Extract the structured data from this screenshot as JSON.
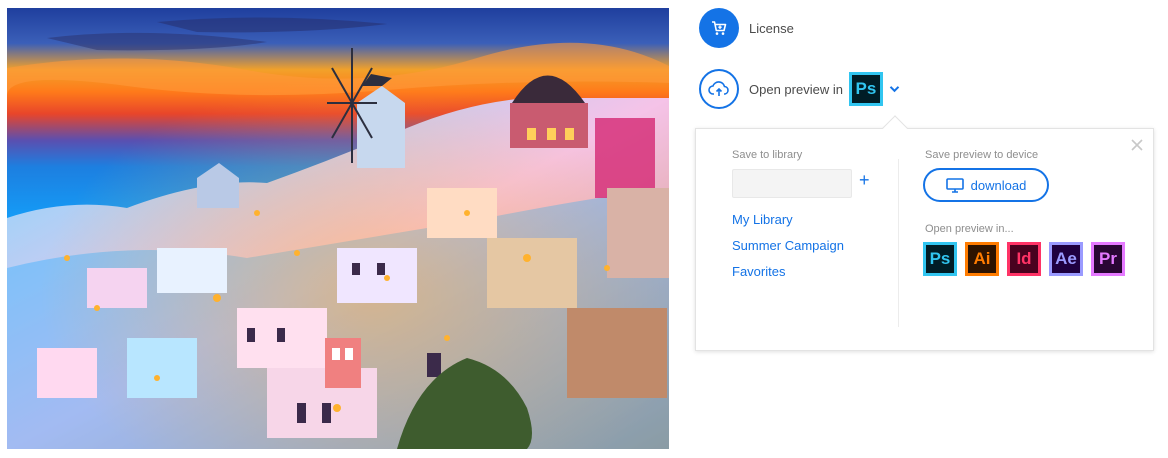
{
  "actions": {
    "license_label": "License",
    "open_preview_label": "Open preview in",
    "current_app": {
      "abbr": "Ps",
      "bg": "#001d26",
      "fg": "#31c5f0"
    }
  },
  "popover": {
    "library": {
      "title": "Save to library",
      "input_value": "",
      "add_icon": "+",
      "items": [
        {
          "label": "My Library"
        },
        {
          "label": "Summer Campaign"
        },
        {
          "label": "Favorites"
        }
      ]
    },
    "device": {
      "title": "Save preview to device",
      "download_label": "download"
    },
    "open_in": {
      "title": "Open preview in...",
      "apps": [
        {
          "abbr": "Ps",
          "bg": "#001d26",
          "fg": "#31c5f0"
        },
        {
          "abbr": "Ai",
          "bg": "#2e1300",
          "fg": "#ff7c00"
        },
        {
          "abbr": "Id",
          "bg": "#49021f",
          "fg": "#ff3366"
        },
        {
          "abbr": "Ae",
          "bg": "#1f0040",
          "fg": "#9a9aff"
        },
        {
          "abbr": "Pr",
          "bg": "#2a0634",
          "fg": "#e579ff"
        }
      ]
    }
  },
  "colors": {
    "accent": "#1473e6"
  }
}
